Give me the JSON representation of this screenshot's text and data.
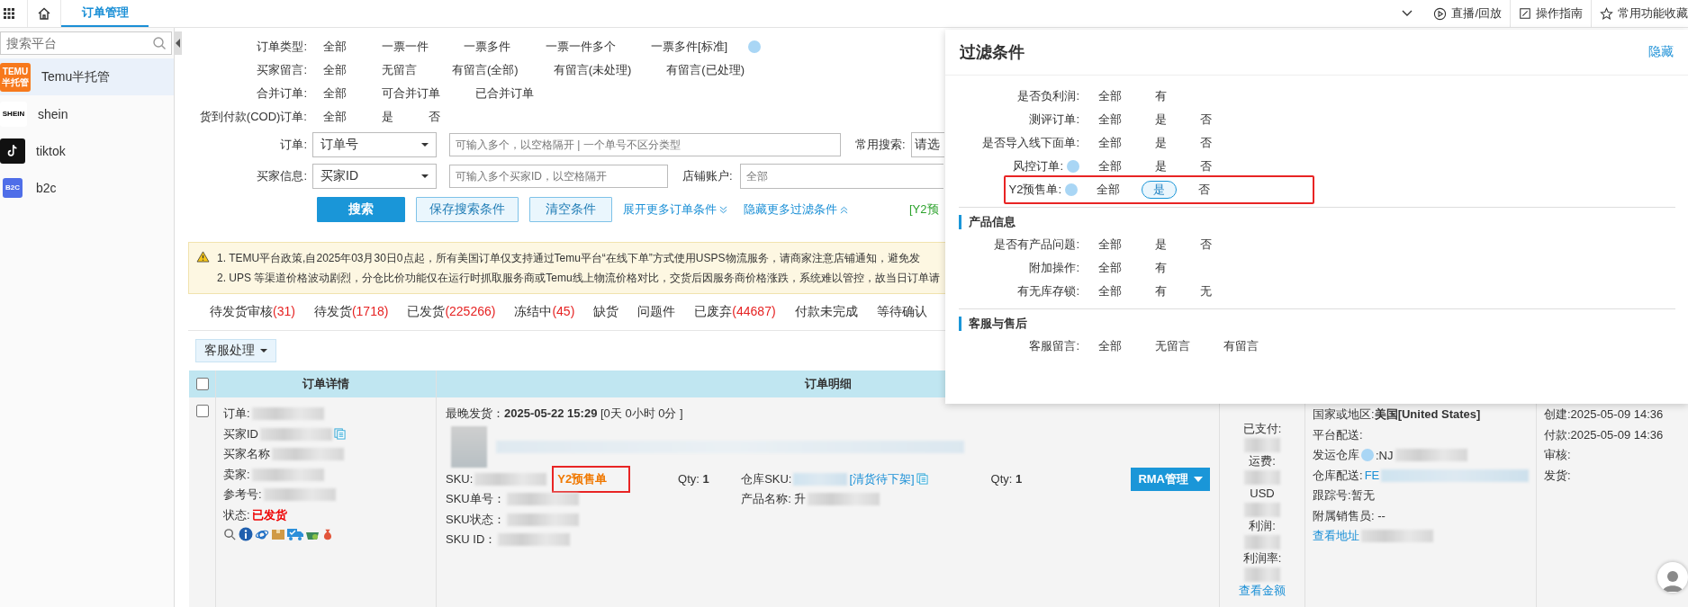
{
  "top_bar": {
    "tabs": [
      {
        "label": "订单管理",
        "selected": true
      }
    ],
    "actions": [
      {
        "label": "直播/回放",
        "kind": "play"
      },
      {
        "label": "操作指南",
        "kind": "guide"
      },
      {
        "label": "常用功能收藏",
        "kind": "star"
      }
    ]
  },
  "sidebar": {
    "search": {
      "placeholder": "搜索平台"
    },
    "items": [
      {
        "label": "Temu半托管",
        "kind": "temu",
        "logo_lines": [
          "TEMU",
          "半托管"
        ],
        "selected": true
      },
      {
        "label": "shein",
        "kind": "shein",
        "logo_lines": [
          "SHEIN"
        ],
        "selected": false
      },
      {
        "label": "tiktok",
        "kind": "tiktok",
        "selected": false
      },
      {
        "label": "b2c",
        "kind": "b2c",
        "logo_lines": [
          "B2C"
        ],
        "selected": false
      }
    ]
  },
  "filters": [
    {
      "label": "订单类型:",
      "help": true,
      "options": [
        {
          "label": "全部",
          "selected": false
        },
        {
          "label": "一票一件",
          "selected": false
        },
        {
          "label": "一票多件",
          "selected": false
        },
        {
          "label": "一票一件多个",
          "selected": false
        },
        {
          "label": "一票多件[标准]",
          "selected": false
        }
      ]
    },
    {
      "label": "买家留言:",
      "options": [
        {
          "label": "全部",
          "selected": false
        },
        {
          "label": "无留言",
          "selected": false
        },
        {
          "label": "有留言(全部)",
          "selected": false
        },
        {
          "label": "有留言(未处理)",
          "selected": false
        },
        {
          "label": "有留言(已处理)",
          "selected": false
        }
      ]
    },
    {
      "label": "合并订单:",
      "options": [
        {
          "label": "全部",
          "selected": false
        },
        {
          "label": "可合并订单",
          "selected": false
        },
        {
          "label": "已合并订单",
          "selected": false
        }
      ]
    },
    {
      "label": "货到付款(COD)订单:",
      "options": [
        {
          "label": "全部",
          "selected": false
        },
        {
          "label": "是",
          "selected": false
        },
        {
          "label": "否",
          "selected": false
        }
      ]
    }
  ],
  "search_form": {
    "order": {
      "label": "订单:",
      "select": "订单号",
      "placeholder": "可输入多个，以空格隔开 | 一个单号不区分类型"
    },
    "common_search": {
      "label": "常用搜索:",
      "value": "请选"
    },
    "buyer": {
      "label": "买家信息:",
      "select": "买家ID",
      "placeholder": "可输入多个买家ID，以空格隔开"
    },
    "shop": {
      "label": "店铺账户:",
      "placeholder": "全部"
    },
    "buttons": [
      {
        "label": "搜索",
        "kind": "primary"
      },
      {
        "label": "保存搜索条件",
        "kind": "secondary"
      },
      {
        "label": "清空条件",
        "kind": "secondary"
      }
    ],
    "links": [
      {
        "label": "展开更多订单条件",
        "kind": "expand"
      },
      {
        "label": "隐藏更多过滤条件",
        "kind": "collapse"
      }
    ],
    "tag": "[Y2预"
  },
  "notice": [
    "1. TEMU平台政策,自2025年03月30日0点起，所有美国订单仅支持通过Temu平台“在线下单”方式使用USPS物流服务，请商家注意店铺通知，避免发",
    "2. UPS 等渠道价格波动剧烈，分仓比价功能仅在运行时抓取服务商或Temu线上物流价格对比，交货后因服务商价格涨跌，系统难以管控，故当日订单请"
  ],
  "status_tabs": [
    {
      "label": "待发货审核",
      "count": "(31)",
      "selected": false
    },
    {
      "label": "待发货",
      "count": "(1718)",
      "selected": false
    },
    {
      "label": "已发货",
      "count": "(225266)",
      "selected": false
    },
    {
      "label": "冻结中",
      "count": "(45)",
      "selected": false
    },
    {
      "label": "缺货",
      "selected": false
    },
    {
      "label": "问题件",
      "selected": false
    },
    {
      "label": "已废弃",
      "count": "(44687)",
      "selected": false
    },
    {
      "label": "付款未完成",
      "selected": false
    },
    {
      "label": "等待确认",
      "selected": false
    }
  ],
  "bulk_action": "客服处理",
  "table": {
    "select_all": {
      "checked": false
    },
    "columns": [
      "订单详情",
      "订单明细"
    ],
    "row": {
      "checked": false,
      "info": [
        {
          "label": "订单:"
        },
        {
          "label": "买家ID",
          "copy": true
        },
        {
          "label": "买家名称"
        },
        {
          "label": "卖家:"
        },
        {
          "label": "参考号:"
        }
      ],
      "status_label": "状态:",
      "status": "已发货",
      "latest_ship": {
        "label": "最晚发货：",
        "date": "2025-05-22 15:29",
        "remaining": "[0天 0小时 0分 ]"
      },
      "sku": {
        "label": "SKU: ",
        "tag": "Y2预售单",
        "highlighted": true
      },
      "sku_lines": [
        "SKU单号：",
        "SKU状态：",
        "SKU ID："
      ],
      "qty_label": "Qty:",
      "qty": "1",
      "warehouse_sku": {
        "label": "仓库SKU:",
        "state": "[清货待下架]"
      },
      "product_name": "产品名称: 升",
      "qty2_label": "Qty:",
      "qty2": "1",
      "rma": "RMA管理",
      "amounts": [
        "已支付:",
        "运费:",
        "USD",
        "利润:",
        "利润率:"
      ],
      "amount_link": "查看金额",
      "address": [
        {
          "text": "国家或地区:**美国[United States]**",
          "kind": "text"
        },
        {
          "text": "平台配送:",
          "kind": "text"
        },
        {
          "text": "发运仓库",
          "kind": "help",
          "tail": ":NJ"
        },
        {
          "text": "仓库配送:",
          "kind": "link",
          "tail": "FE"
        },
        {
          "text": "跟踪号:暂无",
          "kind": "text"
        },
        {
          "text": "附属销售员: --",
          "kind": "text"
        }
      ],
      "address_link": "查看地址",
      "dates": [
        "创建:2025-05-09 14:36",
        "付款:2025-05-09 14:36",
        "审核:",
        "发货:"
      ]
    }
  },
  "filter_panel": {
    "title": "过滤条件",
    "hide": "隐藏",
    "sections": [
      {
        "rows": [
          {
            "label": "是否负利润:",
            "highlighted": false,
            "options": [
              {
                "label": "全部",
                "selected": false
              },
              {
                "label": "有",
                "selected": false
              }
            ]
          },
          {
            "label": "测评订单:",
            "highlighted": false,
            "options": [
              {
                "label": "全部",
                "selected": false
              },
              {
                "label": "是",
                "selected": false
              },
              {
                "label": "否",
                "selected": false
              }
            ]
          },
          {
            "label": "是否导入线下面单:",
            "highlighted": false,
            "options": [
              {
                "label": "全部",
                "selected": false
              },
              {
                "label": "是",
                "selected": false
              },
              {
                "label": "否",
                "selected": false
              }
            ]
          },
          {
            "label": "风控订单:",
            "help": true,
            "highlighted": false,
            "options": [
              {
                "label": "全部",
                "selected": false
              },
              {
                "label": "是",
                "selected": false
              },
              {
                "label": "否",
                "selected": false
              }
            ]
          },
          {
            "label": "Y2预售单:",
            "help": true,
            "highlighted": true,
            "options": [
              {
                "label": "全部",
                "selected": false
              },
              {
                "label": "是",
                "selected": true
              },
              {
                "label": "否",
                "selected": false
              }
            ]
          }
        ]
      },
      {
        "title": "产品信息",
        "rows": [
          {
            "label": "是否有产品问题:",
            "highlighted": false,
            "options": [
              {
                "label": "全部",
                "selected": false
              },
              {
                "label": "是",
                "selected": false
              },
              {
                "label": "否",
                "selected": false
              }
            ]
          },
          {
            "label": "附加操作:",
            "highlighted": false,
            "options": [
              {
                "label": "全部",
                "selected": false
              },
              {
                "label": "有",
                "selected": false
              }
            ]
          },
          {
            "label": "有无库存锁:",
            "highlighted": false,
            "options": [
              {
                "label": "全部",
                "selected": false
              },
              {
                "label": "有",
                "selected": false
              },
              {
                "label": "无",
                "selected": false
              }
            ]
          }
        ]
      },
      {
        "title": "客服与售后",
        "rows": [
          {
            "label": "客服留言:",
            "highlighted": false,
            "options": [
              {
                "label": "全部",
                "selected": false
              },
              {
                "label": "无留言",
                "selected": false
              },
              {
                "label": "有留言",
                "selected": false
              }
            ]
          }
        ]
      }
    ]
  }
}
